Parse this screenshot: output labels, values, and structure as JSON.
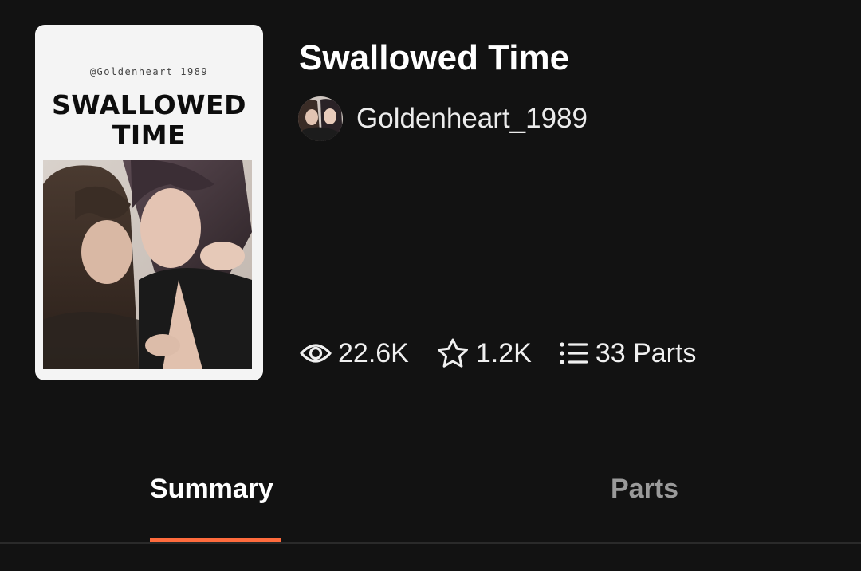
{
  "story": {
    "title": "Swallowed Time",
    "author": "Goldenheart_1989"
  },
  "cover": {
    "handle": "@Goldenheart_1989",
    "title_line1": "SWALLOWED",
    "title_line2": "TIME"
  },
  "stats": {
    "views": "22.6K",
    "votes": "1.2K",
    "parts": "33 Parts"
  },
  "tabs": {
    "summary": "Summary",
    "parts": "Parts",
    "active": "summary"
  },
  "colors": {
    "background": "#121212",
    "accent": "#ff6b3d",
    "inactive_tab": "#9a9a9a"
  },
  "icons": {
    "views": "eye-icon",
    "votes": "star-icon",
    "parts": "list-icon"
  }
}
